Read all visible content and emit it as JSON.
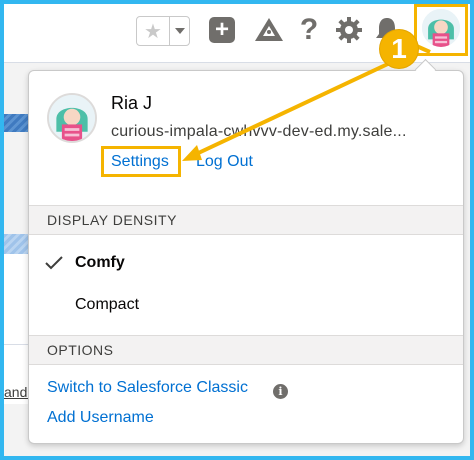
{
  "header": {
    "favorites_star": "★",
    "plus_glyph": "+",
    "help_glyph": "?"
  },
  "callout": {
    "number": "1",
    "color": "#f5b400"
  },
  "background": {
    "cut_text": "andi"
  },
  "user_menu": {
    "name": "Ria J",
    "domain": "curious-impala-cwhvvv-dev-ed.my.sale...",
    "settings_label": "Settings",
    "logout_label": "Log Out",
    "display_density_header": "DISPLAY DENSITY",
    "density_options": [
      {
        "label": "Comfy",
        "selected": true
      },
      {
        "label": "Compact",
        "selected": false
      }
    ],
    "options_header": "OPTIONS",
    "switch_classic_label": "Switch to Salesforce Classic",
    "info_glyph": "i",
    "add_username_label": "Add Username"
  },
  "colors": {
    "link": "#0070d2",
    "highlight": "#f5b400",
    "frame": "#32b7f0"
  }
}
